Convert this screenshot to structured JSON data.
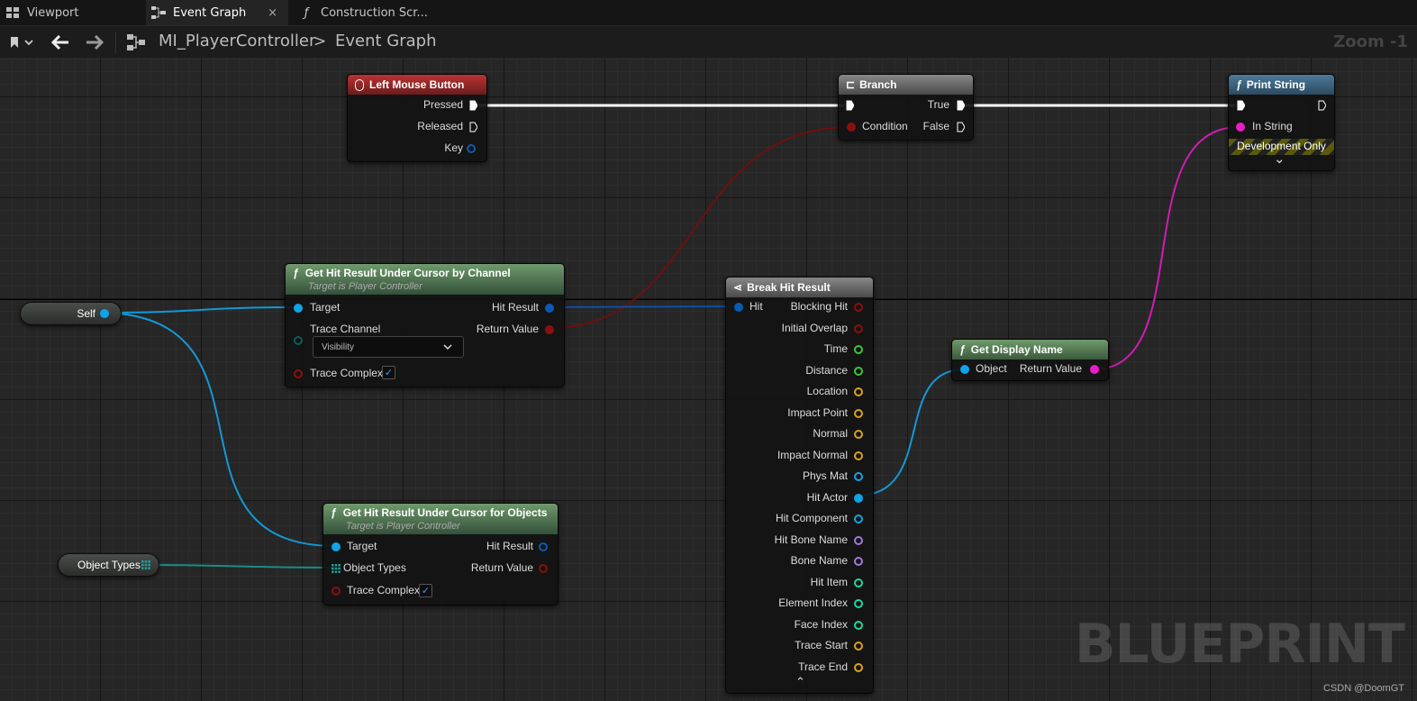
{
  "tabs": [
    {
      "label": "Viewport",
      "icon": "grid-icon"
    },
    {
      "label": "Event Graph",
      "icon": "graph-icon",
      "close": "×"
    },
    {
      "label": "Construction Scr...",
      "icon": "function-icon"
    }
  ],
  "toolbar": {
    "breadcrumb": [
      "MI_PlayerController",
      ">",
      "Event Graph"
    ],
    "zoom": "Zoom -1"
  },
  "nodes": {
    "lmb": {
      "title": "Left Mouse Button",
      "pins": [
        "Pressed",
        "Released",
        "Key"
      ]
    },
    "branch": {
      "title": "Branch",
      "in": [
        "Condition"
      ],
      "out": [
        "True",
        "False"
      ]
    },
    "print": {
      "title": "Print String",
      "in": [
        "In String"
      ],
      "dev": "Development Only",
      "expand": "⌄"
    },
    "hit_channel": {
      "title": "Get Hit Result Under Cursor by Channel",
      "subtitle": "Target is Player Controller",
      "in": [
        "Target",
        "Trace Channel",
        "Trace Complex"
      ],
      "out": [
        "Hit Result",
        "Return Value"
      ],
      "dropdown": "Visibility",
      "check": "✓"
    },
    "hit_objects": {
      "title": "Get Hit Result Under Cursor for Objects",
      "subtitle": "Target is Player Controller",
      "in": [
        "Target",
        "Object Types",
        "Trace Complex"
      ],
      "out": [
        "Hit Result",
        "Return Value"
      ],
      "check": "✓"
    },
    "break": {
      "title": "Break Hit Result",
      "in": [
        "Hit"
      ],
      "out": [
        "Blocking Hit",
        "Initial Overlap",
        "Time",
        "Distance",
        "Location",
        "Impact Point",
        "Normal",
        "Impact Normal",
        "Phys Mat",
        "Hit Actor",
        "Hit Component",
        "Hit Bone Name",
        "Bone Name",
        "Hit Item",
        "Element Index",
        "Face Index",
        "Trace Start",
        "Trace End"
      ],
      "collapse": "⌃"
    },
    "display": {
      "title": "Get Display Name",
      "in": [
        "Object"
      ],
      "out": [
        "Return Value"
      ]
    }
  },
  "vars": {
    "self": "Self",
    "object_types": "Object Types"
  },
  "watermark": "BLUEPRINT",
  "credit": "CSDN @DoomGT",
  "colors": {
    "exec": "#ffffff",
    "bool": "#8b0f0f",
    "object": "#0fa4e8",
    "struct": "#0b5ab3",
    "float": "#38c63c",
    "vector": "#d9a21a",
    "name": "#a07ad9",
    "int": "#1fd6a0",
    "string": "#e91ec9",
    "array": "#1fa09a"
  }
}
